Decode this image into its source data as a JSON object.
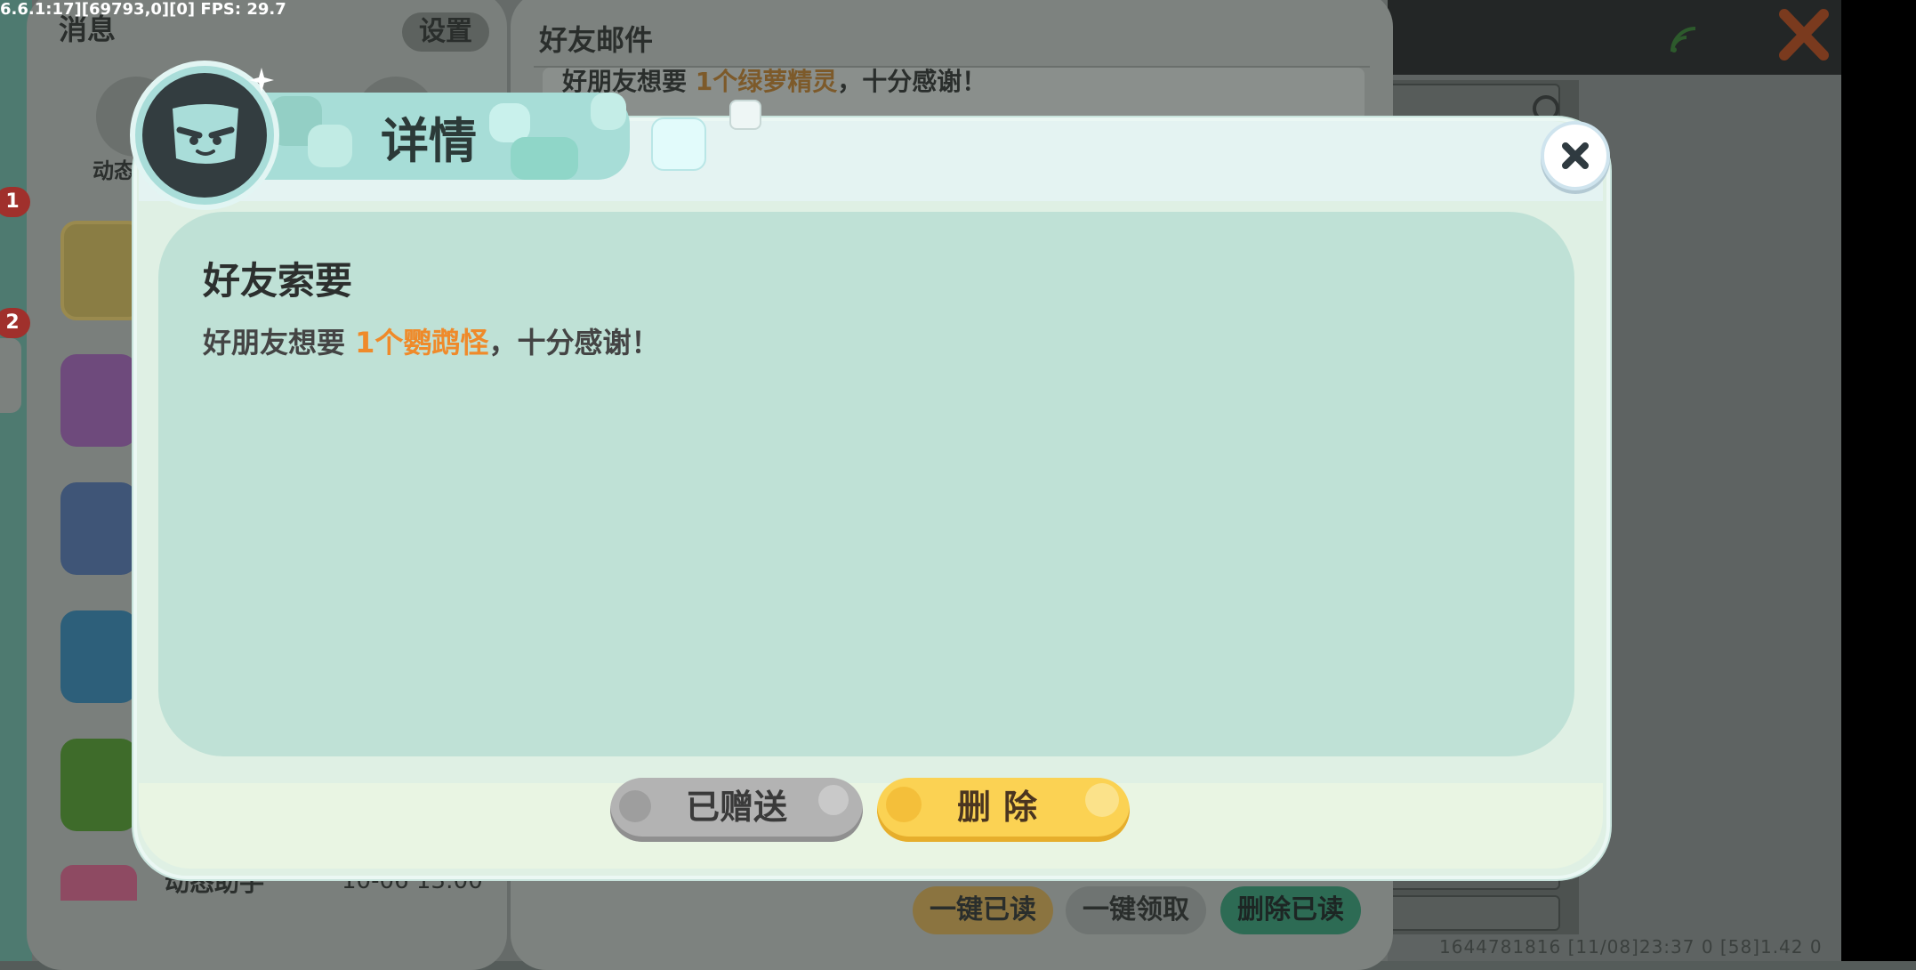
{
  "debug": {
    "text": "6.6.1:17][69793,0][0] FPS: 29.7"
  },
  "messages_panel": {
    "title": "消息",
    "settings_label": "设置",
    "dynamic_label": "动态",
    "badges": [
      "1",
      "2"
    ],
    "last_item": {
      "title": "动态助手",
      "time": "10-06 13:00"
    }
  },
  "mail_panel": {
    "title": "好友邮件",
    "preview_prefix": "好朋友想要",
    "preview_highlight": "1个绿萝精灵",
    "preview_suffix": "，十分感谢！",
    "buttons": {
      "read_all": "一键已读",
      "claim_all": "一键领取",
      "delete_read": "删除已读"
    }
  },
  "footer": {
    "ids": "1644781816    [11/08]23:37 0  [58]1.42 0"
  },
  "dialog": {
    "tab_title": "详情",
    "content_title": "好友索要",
    "message_prefix": "好朋友想要",
    "message_highlight": "1个鹦鹉怪",
    "message_suffix": "，十分感谢！",
    "gifted_label": "已赠送",
    "delete_label": "删除",
    "highlight_color": "#ef8a2a",
    "close_icon": "close-icon"
  }
}
